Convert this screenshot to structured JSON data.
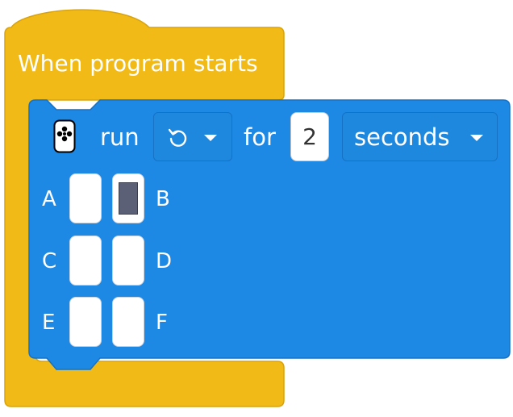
{
  "hat_block": {
    "label": "When program starts",
    "color": "#F1BA16"
  },
  "motor_block": {
    "color": "#1E88E5",
    "icon": "hub-motor-icon",
    "run_label": "run",
    "direction_icon": "rotate-counterclockwise-icon",
    "for_label": "for",
    "duration_value": "2",
    "unit_label": "seconds",
    "ports": [
      {
        "label": "A",
        "selected": false
      },
      {
        "label": "B",
        "selected": true
      },
      {
        "label": "C",
        "selected": false
      },
      {
        "label": "D",
        "selected": false
      },
      {
        "label": "E",
        "selected": false
      },
      {
        "label": "F",
        "selected": false
      }
    ]
  }
}
